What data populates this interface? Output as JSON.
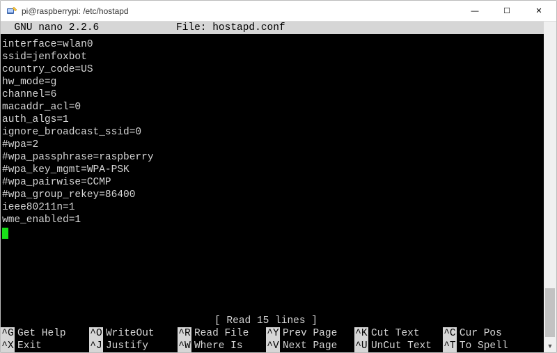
{
  "window": {
    "title": "pi@raspberrypi: /etc/hostapd"
  },
  "nano": {
    "app": "  GNU nano 2.2.6",
    "file_label": "File: hostapd.conf"
  },
  "lines": [
    "interface=wlan0",
    "ssid=jenfoxbot",
    "country_code=US",
    "hw_mode=g",
    "channel=6",
    "macaddr_acl=0",
    "auth_algs=1",
    "ignore_broadcast_ssid=0",
    "#wpa=2",
    "#wpa_passphrase=raspberry",
    "#wpa_key_mgmt=WPA-PSK",
    "#wpa_pairwise=CCMP",
    "#wpa_group_rekey=86400",
    "ieee80211n=1",
    "wme_enabled=1"
  ],
  "status": "[ Read 15 lines ]",
  "shortcuts_row1": [
    {
      "key": "^G",
      "label": "Get Help"
    },
    {
      "key": "^O",
      "label": "WriteOut"
    },
    {
      "key": "^R",
      "label": "Read File"
    },
    {
      "key": "^Y",
      "label": "Prev Page"
    },
    {
      "key": "^K",
      "label": "Cut Text"
    },
    {
      "key": "^C",
      "label": "Cur Pos"
    }
  ],
  "shortcuts_row2": [
    {
      "key": "^X",
      "label": "Exit"
    },
    {
      "key": "^J",
      "label": "Justify"
    },
    {
      "key": "^W",
      "label": "Where Is"
    },
    {
      "key": "^V",
      "label": "Next Page"
    },
    {
      "key": "^U",
      "label": "UnCut Text"
    },
    {
      "key": "^T",
      "label": "To Spell"
    }
  ],
  "winbuttons": {
    "min": "—",
    "max": "☐",
    "close": "✕"
  },
  "scroll": {
    "down": "▼"
  }
}
